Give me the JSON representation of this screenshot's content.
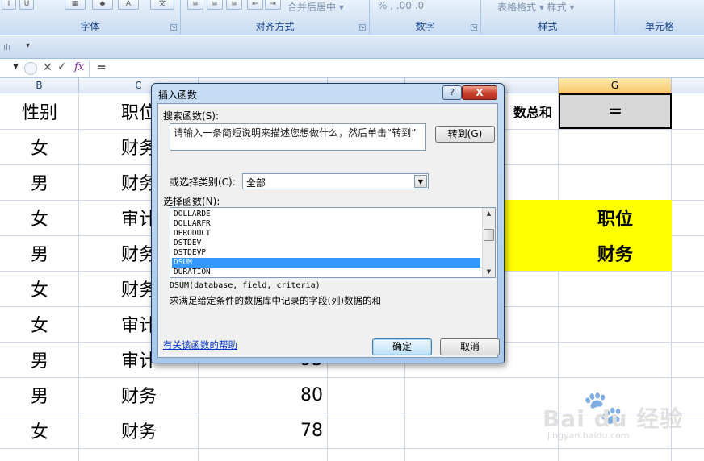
{
  "ribbon": {
    "groups": [
      {
        "label": "字体"
      },
      {
        "label": "对齐方式"
      },
      {
        "label": "数字"
      },
      {
        "label": "样式"
      },
      {
        "label": "单元格"
      }
    ],
    "style_text": "表格格式 ▾ 样式 ▾",
    "merge_text": "合并后居中 ▾",
    "number_fmt": "%  ,   .00 .0"
  },
  "formula_bar": {
    "content": "="
  },
  "columns": [
    {
      "label": "B"
    },
    {
      "label": "C"
    },
    {
      "label": "G"
    }
  ],
  "sheet": {
    "header_row": {
      "gender": "性别",
      "position": "职位",
      "partial_label": "数总和",
      "formula": "="
    },
    "rows": [
      {
        "gender": "女",
        "position": "财务",
        "score": ""
      },
      {
        "gender": "男",
        "position": "财务",
        "score": ""
      },
      {
        "gender": "女",
        "position": "审计",
        "score": ""
      },
      {
        "gender": "男",
        "position": "财务",
        "score": ""
      },
      {
        "gender": "女",
        "position": "财务",
        "score": ""
      },
      {
        "gender": "女",
        "position": "审计",
        "score": ""
      },
      {
        "gender": "男",
        "position": "审计",
        "score": "93"
      },
      {
        "gender": "男",
        "position": "财务",
        "score": "80"
      },
      {
        "gender": "女",
        "position": "财务",
        "score": "78"
      }
    ],
    "criteria": {
      "header": "职位",
      "value": "财务"
    },
    "criteria_color": "#ffff00"
  },
  "dialog": {
    "title": "插入函数",
    "help_glyph": "?",
    "close_glyph": "X",
    "search_label": "搜索函数(S):",
    "search_text": "请输入一条简短说明来描述您想做什么，然后单击“转到”",
    "goto_button": "转到(G)",
    "category_label": "或选择类别(C):",
    "category_value": "全部",
    "function_label": "选择函数(N):",
    "functions": [
      "DOLLARDE",
      "DOLLARFR",
      "DPRODUCT",
      "DSTDEV",
      "DSTDEVP",
      "DSUM",
      "DURATION"
    ],
    "selected_function": "DSUM",
    "selected_color": "#3399ff",
    "signature": "DSUM(database, field, criteria)",
    "description": "求满足给定条件的数据库中记录的字段(列)数据的和",
    "help_link": "有关该函数的帮助",
    "ok_button": "确定",
    "cancel_button": "取消"
  },
  "watermark": {
    "brand": "Bai du 经验",
    "url": "jingyan.baidu.com"
  }
}
